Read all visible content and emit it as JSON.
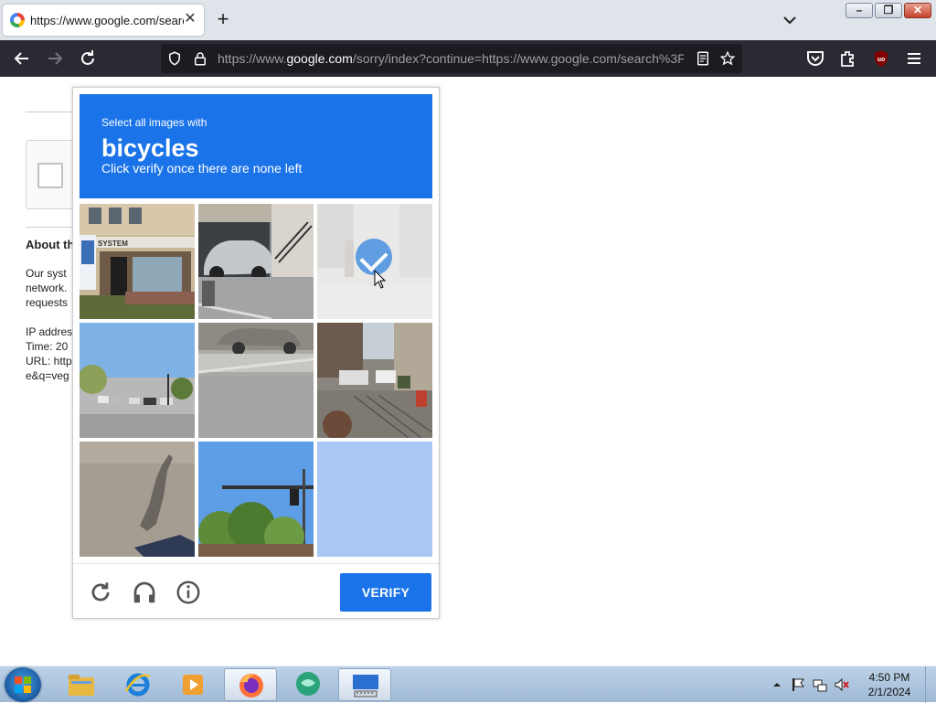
{
  "browser": {
    "tab_title": "https://www.google.com/search?q=vegan+pizza",
    "url_prefix": "https://www.",
    "url_domain": "google.com",
    "url_rest": "/sorry/index?continue=https://www.google.com/search%3F",
    "icons": {
      "back": "arrow-left",
      "forward": "arrow-right",
      "reload": "reload",
      "shield": "shield",
      "lock": "lock",
      "reader": "reader-view",
      "bookmark": "star",
      "pocket": "pocket",
      "extensions": "puzzle",
      "ublock": "ublock-origin",
      "menu": "hamburger"
    }
  },
  "background_page": {
    "about_heading": "About th",
    "para_lines": [
      "Our syst",
      "network.",
      "requests"
    ],
    "info_lines": [
      "IP addres",
      "Time: 20",
      "URL: http",
      "e&q=veg"
    ]
  },
  "captcha": {
    "instruction_line1": "Select all images with",
    "target": "bicycles",
    "instruction_line3": "Click verify once there are none left",
    "verify_label": "VERIFY",
    "accent_color": "#1a73e8",
    "tiles": [
      {
        "name": "storefront",
        "selected": false
      },
      {
        "name": "car-in-garage",
        "selected": false
      },
      {
        "name": "faded-street",
        "selected": true
      },
      {
        "name": "intersection-trees",
        "selected": false
      },
      {
        "name": "road-median",
        "selected": false
      },
      {
        "name": "busy-street",
        "selected": false
      },
      {
        "name": "shadow-on-pavement",
        "selected": false
      },
      {
        "name": "traffic-light-trees",
        "selected": false
      },
      {
        "name": "loading-tile",
        "selected": false
      }
    ]
  },
  "taskbar": {
    "time": "4:50 PM",
    "date": "2/1/2024",
    "apps": [
      "file-explorer",
      "internet-explorer",
      "media-player",
      "firefox",
      "chat-app",
      "on-screen-keyboard"
    ]
  }
}
